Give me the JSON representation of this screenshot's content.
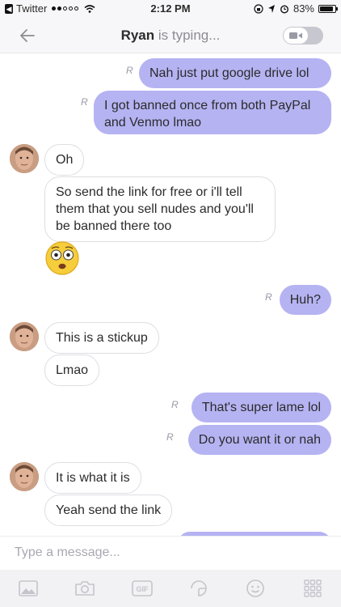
{
  "status_bar": {
    "carrier": "Twitter",
    "time": "2:12 PM",
    "battery": "83%"
  },
  "header": {
    "contact_name": "Ryan",
    "typing_status": "is typing..."
  },
  "messages": [
    {
      "side": "out",
      "text": "Nah just put google drive lol",
      "seen_mark": "R"
    },
    {
      "side": "out",
      "text": "I got banned once from both PayPal and Venmo lmao",
      "seen_mark": "R"
    },
    {
      "side": "in",
      "text": "Oh"
    },
    {
      "side": "in",
      "text": "So send the link for free or i'll tell them that you sell nudes and you'll be banned there too"
    },
    {
      "side": "in",
      "sticker": "flushed-emoji"
    },
    {
      "side": "out",
      "text": "Huh?",
      "seen_mark": "R"
    },
    {
      "side": "in",
      "text": "This is a stickup"
    },
    {
      "side": "in",
      "text": "Lmao"
    },
    {
      "side": "out",
      "text": "That's super lame lol",
      "seen_mark": "R"
    },
    {
      "side": "out",
      "text": "Do you want it or nah",
      "seen_mark": "R"
    },
    {
      "side": "in",
      "text": "It is what it is"
    },
    {
      "side": "in",
      "text": "Yeah send the link"
    }
  ],
  "composer": {
    "placeholder": "Type a message..."
  },
  "toolbar": {
    "items": [
      "image-icon",
      "camera-icon",
      "gif-icon",
      "sticker-icon",
      "emoji-icon",
      "apps-grid-icon"
    ],
    "gif_label": "GIF"
  },
  "colors": {
    "outgoing_bubble": "#b5b3f2",
    "incoming_bubble": "#ffffff",
    "accent": "#8f8df0"
  }
}
